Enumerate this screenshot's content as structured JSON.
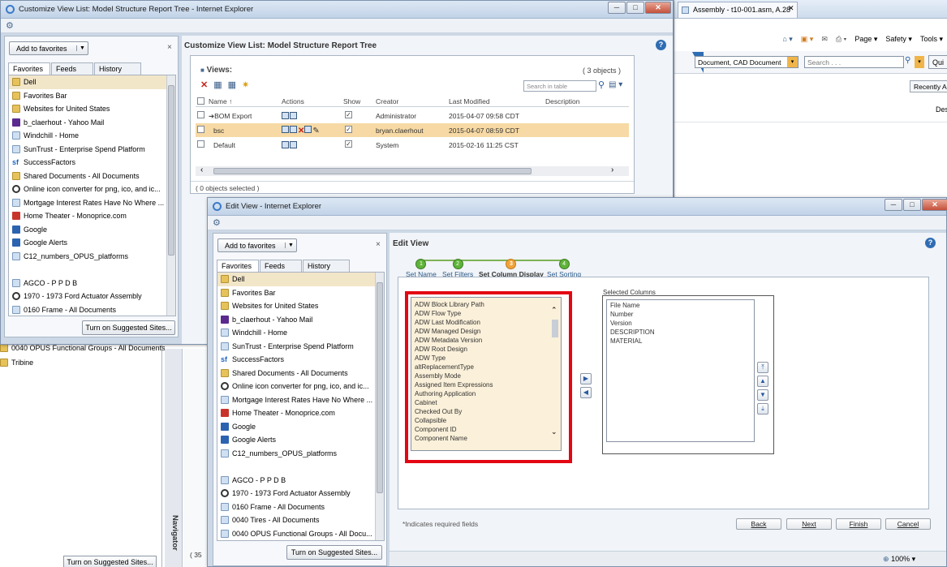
{
  "main_window": {
    "title": "Customize View List: Model Structure Report Tree - Internet Explorer",
    "page_heading": "Customize View List: Model Structure Report Tree",
    "views": {
      "label": "Views:",
      "count": "( 3 objects )",
      "search_placeholder": "Search in table",
      "columns": [
        "Name",
        "Actions",
        "Show",
        "Creator",
        "Last Modified",
        "Description"
      ],
      "rows": [
        {
          "name": "BOM Export",
          "creator": "Administrator",
          "modified": "2015-04-07 09:58 CDT"
        },
        {
          "name": "bsc",
          "creator": "bryan.claerhout",
          "modified": "2015-04-07 08:59 CDT"
        },
        {
          "name": "Default",
          "creator": "System",
          "modified": "2015-02-16 11:25 CST"
        }
      ],
      "footer": "( 0 objects selected )"
    }
  },
  "favorites_panel": {
    "add_button": "Add to favorites",
    "tabs": [
      "Favorites",
      "Feeds",
      "History"
    ],
    "items": [
      {
        "label": "Dell",
        "icon": "folder"
      },
      {
        "label": "Favorites Bar",
        "icon": "folder"
      },
      {
        "label": "Websites for United States",
        "icon": "folder"
      },
      {
        "label": "b_claerhout - Yahoo Mail",
        "icon": "yahoo"
      },
      {
        "label": "Windchill - Home",
        "icon": "page"
      },
      {
        "label": "SunTrust - Enterprise Spend Platform",
        "icon": "page"
      },
      {
        "label": "SuccessFactors",
        "icon": "sf"
      },
      {
        "label": "Shared Documents - All Documents",
        "icon": "folder"
      },
      {
        "label": "Online icon converter for png, ico, and ic...",
        "icon": "circle"
      },
      {
        "label": "Mortgage Interest Rates Have No Where ...",
        "icon": "page"
      },
      {
        "label": "Home Theater - Monoprice.com",
        "icon": "red"
      },
      {
        "label": "Google",
        "icon": "blue"
      },
      {
        "label": "Google Alerts",
        "icon": "blue"
      },
      {
        "label": "C12_numbers_OPUS_platforms",
        "icon": "page"
      },
      {
        "label": "",
        "icon": "none"
      },
      {
        "label": "AGCO - P P D B",
        "icon": "page"
      },
      {
        "label": "1970 - 1973 Ford Actuator Assembly",
        "icon": "circle"
      },
      {
        "label": "0160 Frame - All Documents",
        "icon": "page"
      },
      {
        "label": "0040 Tires - All Documents",
        "icon": "page"
      },
      {
        "label": "0040 OPUS Functional Groups - All Docu...",
        "icon": "page"
      }
    ],
    "suggested_sites": "Turn on Suggested Sites..."
  },
  "background_items": {
    "opus_groups": "0040 OPUS Functional Groups - All Documents",
    "tribine": "Tribine",
    "navigator": "Navigator",
    "suggested_sites_bottom": "Turn on Suggested Sites...",
    "count_bottom": "( 35"
  },
  "right_browser": {
    "tab_title": "Assembly - t10-001.asm, A.28",
    "menu": [
      "Page",
      "Safety",
      "Tools"
    ],
    "doc_type": "Document, CAD Document",
    "search_placeholder": "Search . . .",
    "quick": "Qui",
    "recently": "Recently A",
    "des": "Des"
  },
  "edit_view": {
    "window_title": "Edit View - Internet Explorer",
    "heading": "Edit View",
    "steps": [
      {
        "num": "1",
        "label": "Set Name"
      },
      {
        "num": "2",
        "label": "Set Filters"
      },
      {
        "num": "3",
        "label": "Set Column Display"
      },
      {
        "num": "4",
        "label": "Set Sorting"
      }
    ],
    "available_columns": [
      "ADW Block Library Path",
      "ADW Flow Type",
      "ADW Last Modification",
      "ADW Managed Design",
      "ADW Metadata Version",
      "ADW Root Design",
      "ADW Type",
      "altReplacementType",
      "Assembly Mode",
      "Assigned Item Expressions",
      "Authoring Application",
      "Cabinet",
      "Checked Out By",
      "Collapsible",
      "Component ID",
      "Component Name"
    ],
    "selected_label": "Selected Columns",
    "selected_columns": [
      "File Name",
      "Number",
      "Version",
      "DESCRIPTION",
      "MATERIAL"
    ],
    "required_note": "*Indicates required fields",
    "buttons": {
      "back": "Back",
      "next": "Next",
      "finish": "Finish",
      "cancel": "Cancel"
    },
    "zoom": "100%"
  },
  "colors": {
    "highlight_red": "#e30613",
    "row_highlight": "#f6d9a4",
    "step_green": "#5fb33a",
    "step_current": "#f0a33a"
  }
}
